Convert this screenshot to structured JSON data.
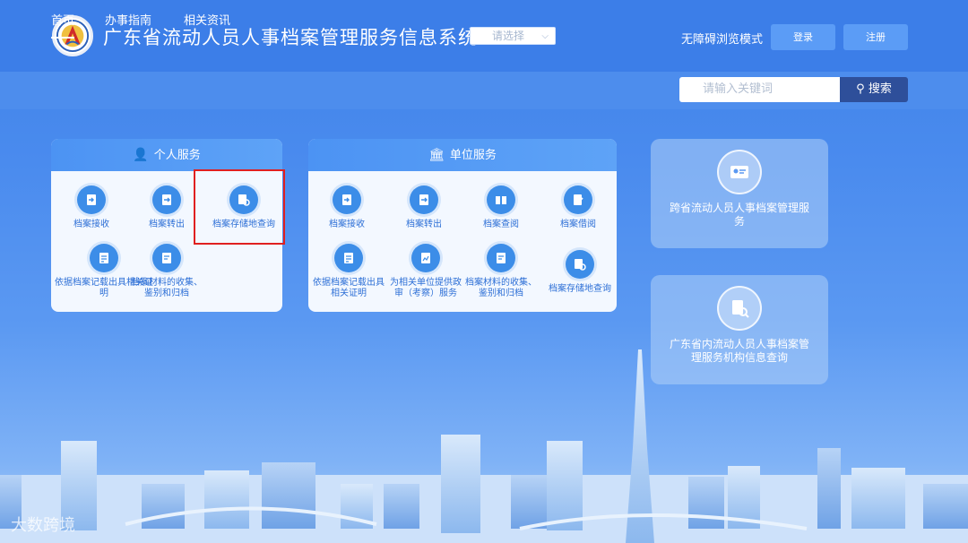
{
  "header": {
    "title": "广东省流动人员人事档案管理服务信息系统",
    "select_placeholder": "请选择",
    "accessibility_label": "无障碍浏览模式",
    "login_label": "登录",
    "register_label": "注册"
  },
  "nav": {
    "items": [
      "首页",
      "办事指南",
      "相关资讯"
    ],
    "search_placeholder": "请输入关键词",
    "search_button": "搜索"
  },
  "personal": {
    "title": "个人服务",
    "items": [
      {
        "label": "档案接收",
        "icon": "file-receive-icon"
      },
      {
        "label": "档案转出",
        "icon": "file-transfer-icon"
      },
      {
        "label": "档案存储地查询",
        "icon": "file-search-icon"
      },
      {
        "label": "依据档案记载出具相关证明",
        "icon": "certificate-icon"
      },
      {
        "label": "档案材料的收集、鉴别和归档",
        "icon": "archive-icon"
      }
    ]
  },
  "unit": {
    "title": "单位服务",
    "items": [
      {
        "label": "档案接收",
        "icon": "file-receive-icon"
      },
      {
        "label": "档案转出",
        "icon": "file-transfer-icon"
      },
      {
        "label": "档案查阅",
        "icon": "book-icon"
      },
      {
        "label": "档案借阅",
        "icon": "file-edit-icon"
      },
      {
        "label": "依据档案记载出具相关证明",
        "icon": "certificate-icon"
      },
      {
        "label": "为相关单位提供政审（考察）服务",
        "icon": "review-icon"
      },
      {
        "label": "档案材料的收集、鉴别和归档",
        "icon": "archive-icon"
      },
      {
        "label": "档案存储地查询",
        "icon": "file-search-icon"
      }
    ]
  },
  "cards": {
    "card1": "跨省流动人员人事档案管理服务",
    "card2": "广东省内流动人员人事档案管理服务机构信息查询"
  },
  "watermark": "大数跨境",
  "colors": {
    "accent": "#3c7ee8",
    "search_button": "#2e4f9a",
    "icon_blue": "#3c8de8",
    "highlight_border": "#e02020"
  }
}
